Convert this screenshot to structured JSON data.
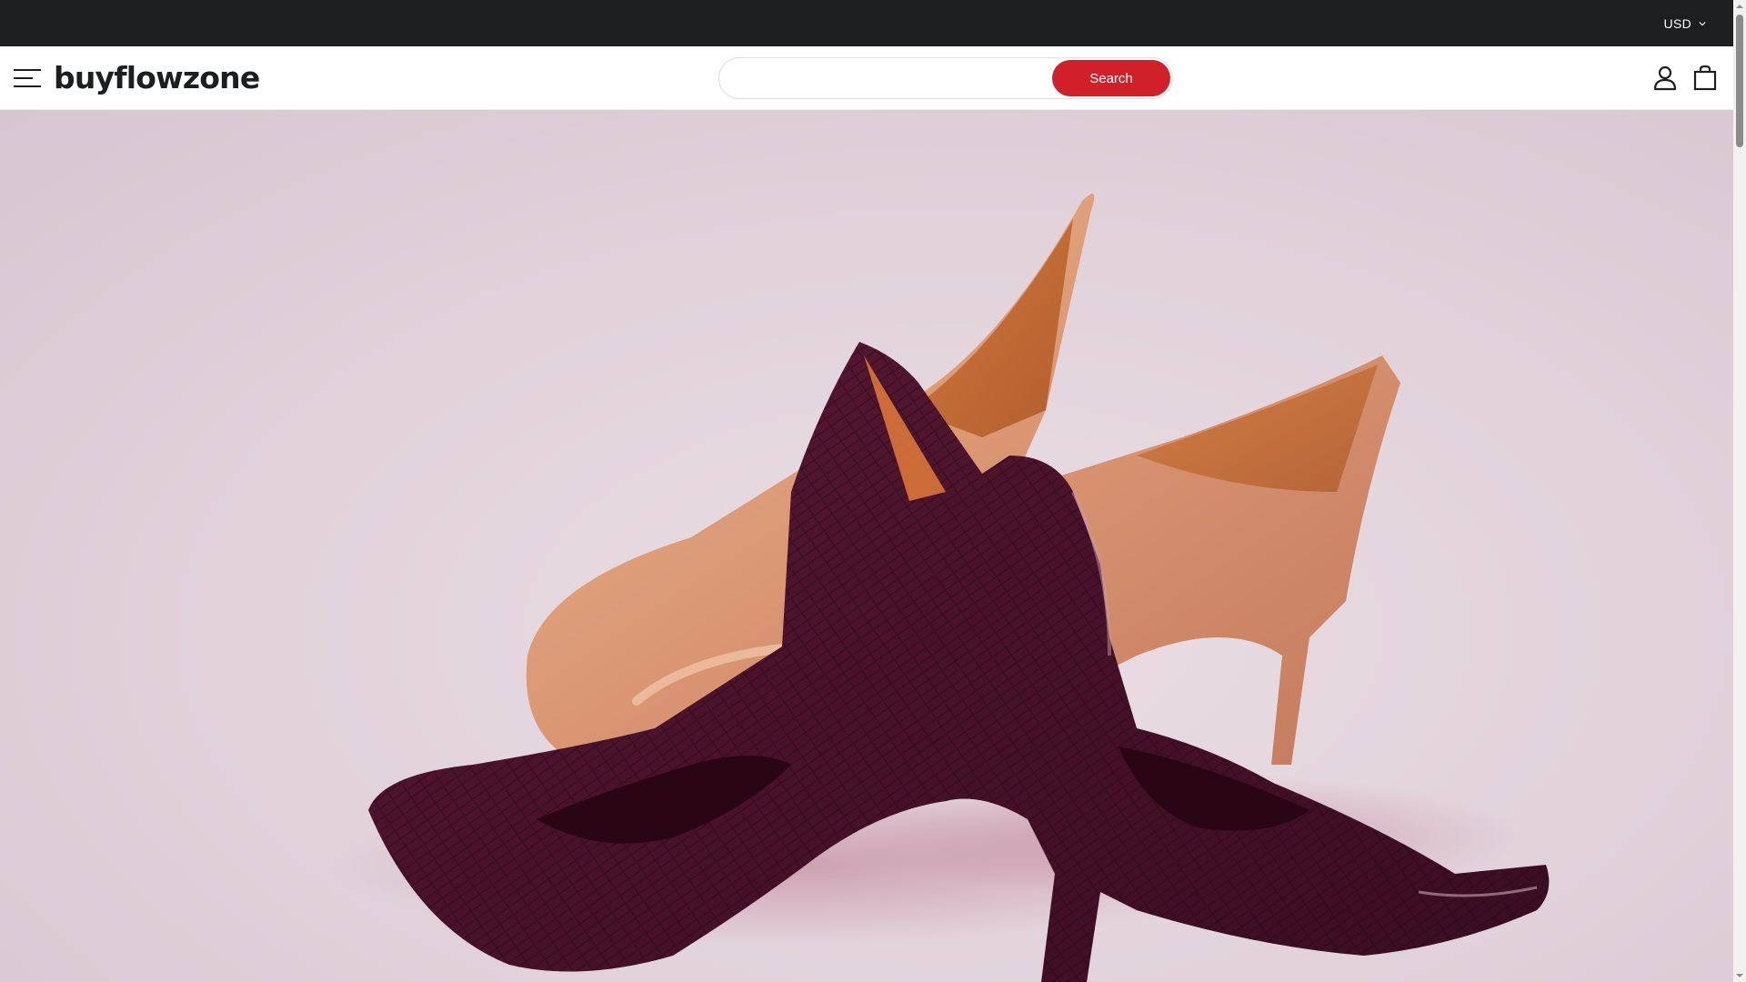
{
  "topbar": {
    "currency": "USD",
    "currency_icon": "chevron-down-icon"
  },
  "header": {
    "logo": "buyflowzone",
    "menu_icon": "hamburger-menu-icon",
    "search": {
      "placeholder": "",
      "value": "",
      "button_label": "Search"
    },
    "account_icon": "user-icon",
    "cart_icon": "shopping-bag-icon"
  },
  "hero": {
    "image_description": "Hero banner photo of burgundy lizard-textured and nude patent stiletto pumps on a pale pink background",
    "image_alt": ""
  },
  "colors": {
    "topbar_bg": "#1d1e20",
    "search_button": "#d0202a",
    "text": "#1d1e20",
    "hero_bg": "#e3d6dc"
  }
}
